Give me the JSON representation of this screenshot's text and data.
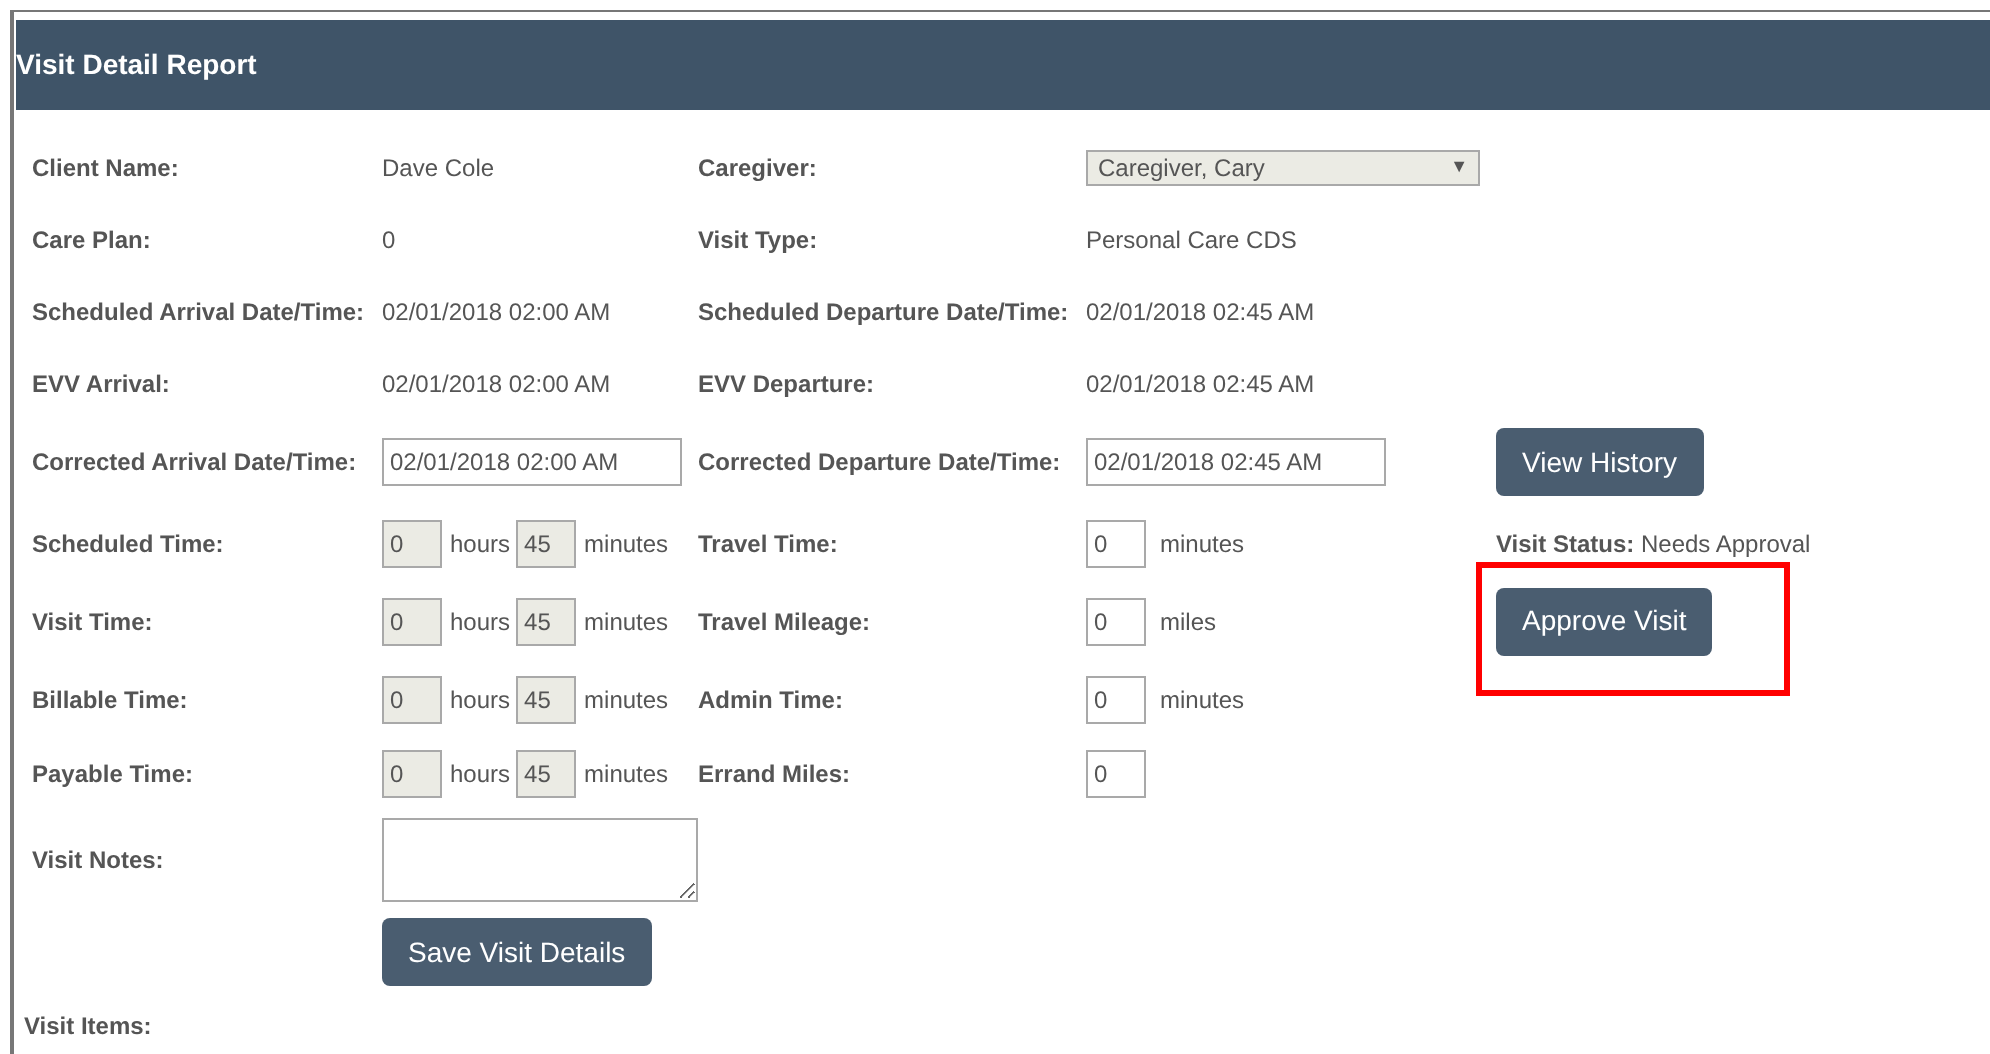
{
  "header": {
    "title": "Visit Detail Report"
  },
  "rows": [
    {
      "cells": [
        {
          "kind": "label",
          "text": "Client Name:"
        },
        {
          "kind": "text",
          "text": "Dave Cole"
        },
        {
          "kind": "label",
          "text": "Caregiver:"
        },
        {
          "kind": "select",
          "value": "Caregiver, Cary",
          "arrow": "▼"
        }
      ]
    },
    {
      "cells": [
        {
          "kind": "label",
          "text": "Care Plan:"
        },
        {
          "kind": "text",
          "text": "0"
        },
        {
          "kind": "label",
          "text": "Visit Type:"
        },
        {
          "kind": "text",
          "text": "Personal Care CDS"
        }
      ]
    },
    {
      "cells": [
        {
          "kind": "label",
          "text": "Scheduled Arrival Date/Time:"
        },
        {
          "kind": "text",
          "text": "02/01/2018 02:00 AM"
        },
        {
          "kind": "label",
          "text": "Scheduled Departure Date/Time:"
        },
        {
          "kind": "text",
          "text": "02/01/2018 02:45 AM"
        }
      ]
    },
    {
      "cells": [
        {
          "kind": "label",
          "text": "EVV Arrival:"
        },
        {
          "kind": "text",
          "text": "02/01/2018 02:00 AM"
        },
        {
          "kind": "label",
          "text": "EVV Departure:"
        },
        {
          "kind": "text",
          "text": "02/01/2018 02:45 AM"
        }
      ]
    },
    {
      "cells": [
        {
          "kind": "label",
          "text": "Corrected Arrival Date/Time:"
        },
        {
          "kind": "input",
          "value": "02/01/2018 02:00 AM"
        },
        {
          "kind": "label",
          "text": "Corrected Departure Date/Time:"
        },
        {
          "kind": "input",
          "value": "02/01/2018 02:45 AM"
        },
        {
          "kind": "button",
          "text": "View History"
        }
      ]
    },
    {
      "cells": [
        {
          "kind": "label",
          "text": "Scheduled Time:"
        },
        {
          "kind": "duration",
          "hours": "0",
          "hours_unit": "hours",
          "minutes": "45",
          "minutes_unit": "minutes",
          "disabled": true
        },
        {
          "kind": "label",
          "text": "Travel Time:"
        },
        {
          "kind": "number",
          "value": "0",
          "unit": "minutes"
        },
        {
          "kind": "status",
          "label": "Visit Status:",
          "value": "Needs Approval"
        }
      ]
    },
    {
      "cells": [
        {
          "kind": "label",
          "text": "Visit Time:"
        },
        {
          "kind": "duration",
          "hours": "0",
          "hours_unit": "hours",
          "minutes": "45",
          "minutes_unit": "minutes",
          "disabled": true
        },
        {
          "kind": "label",
          "text": "Travel Mileage:"
        },
        {
          "kind": "number",
          "value": "0",
          "unit": "miles"
        },
        {
          "kind": "button",
          "text": "Approve Visit",
          "highlighted": true
        }
      ]
    },
    {
      "cells": [
        {
          "kind": "label",
          "text": "Billable Time:"
        },
        {
          "kind": "duration",
          "hours": "0",
          "hours_unit": "hours",
          "minutes": "45",
          "minutes_unit": "minutes",
          "disabled": true
        },
        {
          "kind": "label",
          "text": "Admin Time:"
        },
        {
          "kind": "number",
          "value": "0",
          "unit": "minutes"
        }
      ]
    },
    {
      "cells": [
        {
          "kind": "label",
          "text": "Payable Time:"
        },
        {
          "kind": "duration",
          "hours": "0",
          "hours_unit": "hours",
          "minutes": "45",
          "minutes_unit": "minutes",
          "disabled": true
        },
        {
          "kind": "label",
          "text": "Errand Miles:"
        },
        {
          "kind": "number",
          "value": "0"
        }
      ]
    },
    {
      "cells": [
        {
          "kind": "label",
          "text": "Visit Notes:"
        },
        {
          "kind": "textarea"
        }
      ]
    },
    {
      "cells": [
        {
          "kind": "empty"
        },
        {
          "kind": "button",
          "text": "Save Visit Details"
        }
      ]
    }
  ],
  "section": {
    "title": "Visit Items:"
  }
}
